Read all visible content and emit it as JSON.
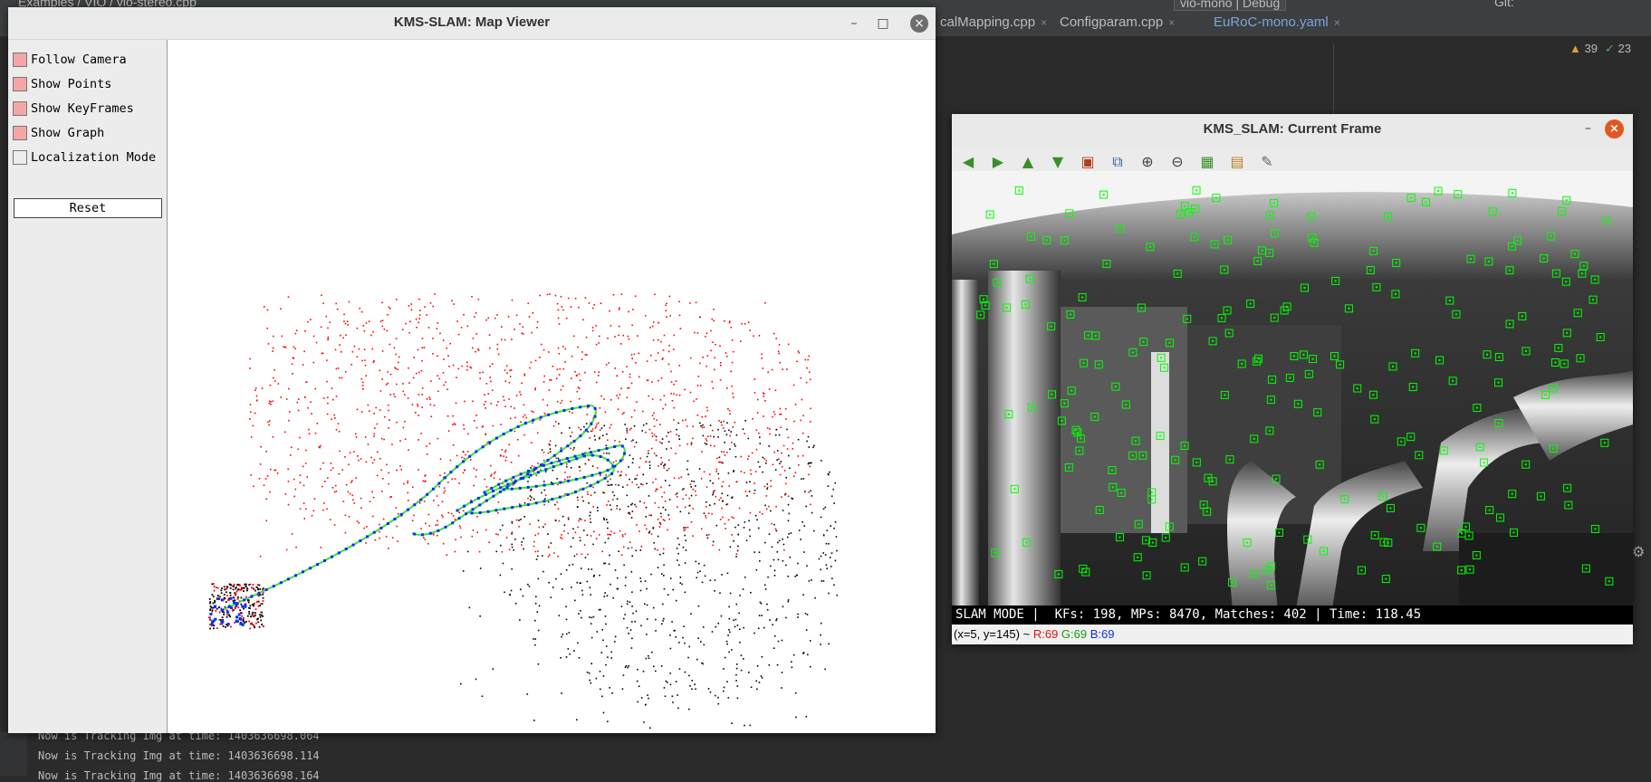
{
  "ide": {
    "breadcrumb": "Examples / VIO / vio-stereo.cpp",
    "tabs": [
      {
        "label": "calMapping.cpp",
        "close": "×",
        "color": "#bbbbbb"
      },
      {
        "label": "Configparam.cpp",
        "close": "×",
        "color": "#bbbbbb"
      },
      {
        "label": "EuRoC-mono.yaml",
        "close": "×",
        "color": "#7ea4d6"
      }
    ],
    "run_config": "vio-mono | Debug",
    "git_label": "Git:",
    "warnings": "39",
    "checks": "23",
    "console": [
      "Now is Tracking Img at time: 1403636698.064",
      "Now is Tracking Img at time: 1403636698.114",
      "Now is Tracking Img at time: 1403636698.164"
    ]
  },
  "map_viewer": {
    "title": "KMS-SLAM: Map Viewer",
    "minimize": "–",
    "maximize": "□",
    "close": "×",
    "options": [
      {
        "label": "Follow Camera",
        "checked": true
      },
      {
        "label": "Show Points",
        "checked": true
      },
      {
        "label": "Show KeyFrames",
        "checked": true
      },
      {
        "label": "Show Graph",
        "checked": true
      },
      {
        "label": "Localization Mode",
        "checked": false
      }
    ],
    "reset_label": "Reset"
  },
  "current_frame": {
    "title": "KMS_SLAM: Current Frame",
    "minimize": "–",
    "close": "×",
    "toolbar": [
      {
        "name": "pan-left-icon",
        "glyph": "◀",
        "color": "#3a8f2a"
      },
      {
        "name": "pan-right-icon",
        "glyph": "▶",
        "color": "#3a8f2a"
      },
      {
        "name": "pan-up-icon",
        "glyph": "▲",
        "color": "#3a8f2a"
      },
      {
        "name": "pan-down-icon",
        "glyph": "▼",
        "color": "#3a8f2a"
      },
      {
        "name": "zoom-fit-icon",
        "glyph": "▣",
        "color": "#b04020"
      },
      {
        "name": "zoom-original-icon",
        "glyph": "⧉",
        "color": "#3060b0"
      },
      {
        "name": "zoom-in-icon",
        "glyph": "⊕",
        "color": "#444"
      },
      {
        "name": "zoom-out-icon",
        "glyph": "⊖",
        "color": "#444"
      },
      {
        "name": "save-icon",
        "glyph": "▦",
        "color": "#3a8f2a"
      },
      {
        "name": "copy-icon",
        "glyph": "▤",
        "color": "#c08020"
      },
      {
        "name": "properties-icon",
        "glyph": "✎",
        "color": "#666"
      }
    ],
    "status": "SLAM MODE |  KFs: 198, MPs: 8470, Matches: 402 | Time: 118.45",
    "pixel_pos": "(x=5, y=145) ~",
    "pixel_r": "R:69",
    "pixel_g": "G:69",
    "pixel_b": "B:69"
  },
  "colors": {
    "map_points": "#ff0000",
    "ref_points": "#000000",
    "graph": "#3fe03f",
    "keyframes": "#0030ff",
    "features": "#00ff00"
  }
}
